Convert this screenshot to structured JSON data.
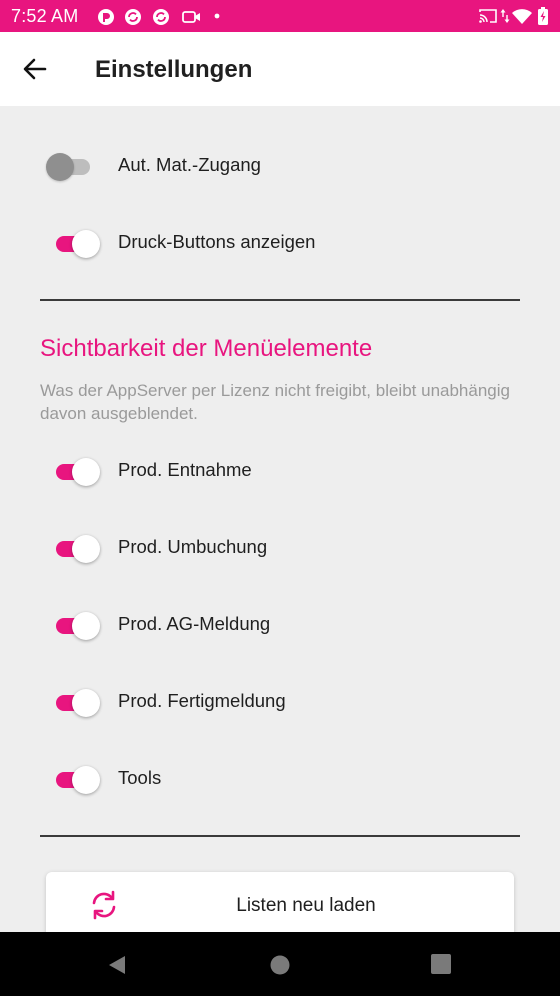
{
  "status_bar": {
    "time": "7:52 AM",
    "icons_left": [
      "app-icon-1",
      "sync-icon",
      "sync-icon",
      "camera-icon",
      "dot-icon"
    ],
    "icons_right": [
      "cast-icon",
      "data-arrows-icon",
      "wifi-icon",
      "battery-charging-icon"
    ],
    "color": "#e8157f"
  },
  "app_bar": {
    "title": "Einstellungen",
    "back_icon": "arrow-left-icon"
  },
  "settings": {
    "toggles": [
      {
        "label": "Aut. Mat.-Zugang",
        "on": false
      },
      {
        "label": "Druck-Buttons anzeigen",
        "on": true
      }
    ]
  },
  "menu_section": {
    "title": "Sichtbarkeit der Menüelemente",
    "description": "Was der AppServer per Lizenz nicht freigibt, bleibt unabhängig davon ausgeblendet.",
    "toggles": [
      {
        "label": "Prod. Entnahme",
        "on": true
      },
      {
        "label": "Prod. Umbuchung",
        "on": true
      },
      {
        "label": "Prod. AG-Meldung",
        "on": true
      },
      {
        "label": "Prod. Fertigmeldung",
        "on": true
      },
      {
        "label": "Tools",
        "on": true
      }
    ]
  },
  "reload_button": {
    "label": "Listen neu laden",
    "icon": "refresh-icon"
  },
  "nav_bar": {
    "buttons": [
      "back-triangle-icon",
      "home-circle-icon",
      "recents-square-icon"
    ]
  },
  "colors": {
    "accent": "#e8157f",
    "background": "#eeeeee",
    "toggle_off": "#8f8f8f"
  }
}
